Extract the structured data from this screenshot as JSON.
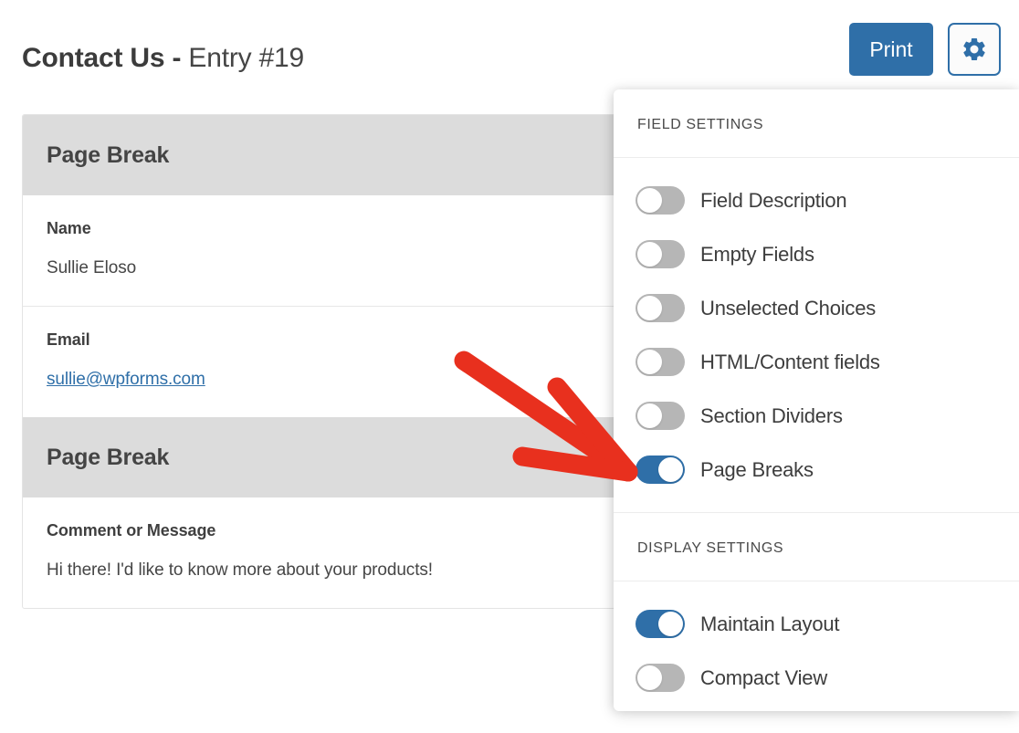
{
  "header": {
    "title_strong": "Contact Us - ",
    "title_rest": "Entry #19",
    "print_label": "Print",
    "settings_icon": "gear-icon"
  },
  "entry": {
    "blocks": [
      {
        "type": "page-break",
        "label": "Page Break"
      },
      {
        "type": "field",
        "label": "Name",
        "value": "Sullie Eloso"
      },
      {
        "type": "field-link",
        "label": "Email",
        "value": "sullie@wpforms.com"
      },
      {
        "type": "page-break",
        "label": "Page Break"
      },
      {
        "type": "field",
        "label": "Comment or Message",
        "value": "Hi there! I'd like to know more about your products!"
      }
    ]
  },
  "settings_panel": {
    "sections": [
      {
        "heading": "FIELD SETTINGS",
        "toggles": [
          {
            "label": "Field Description",
            "on": false
          },
          {
            "label": "Empty Fields",
            "on": false
          },
          {
            "label": "Unselected Choices",
            "on": false
          },
          {
            "label": "HTML/Content fields",
            "on": false
          },
          {
            "label": "Section Dividers",
            "on": false
          },
          {
            "label": "Page Breaks",
            "on": true
          }
        ]
      },
      {
        "heading": "DISPLAY SETTINGS",
        "toggles": [
          {
            "label": "Maintain Layout",
            "on": true
          },
          {
            "label": "Compact View",
            "on": false
          }
        ]
      }
    ]
  },
  "annotation": {
    "type": "arrow",
    "color": "#e8301e",
    "points_to": "Page Breaks"
  },
  "colors": {
    "accent_blue": "#2f6fa8",
    "toggle_off_gray": "#b6b6b6",
    "page_break_band": "#dcdcdc",
    "annotation_red": "#e8301e",
    "text_dark": "#3d3d3d"
  }
}
